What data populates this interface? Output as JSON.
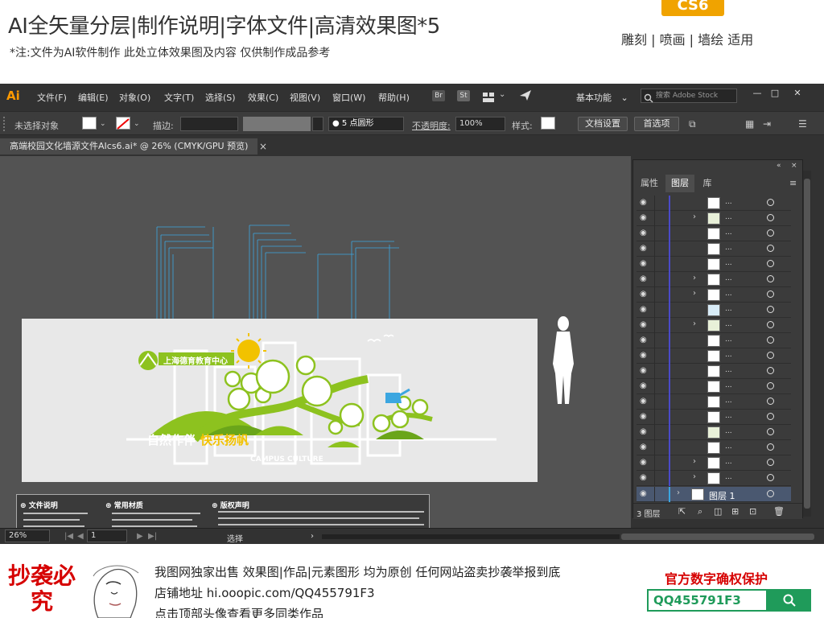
{
  "banner": {
    "title": "AI全矢量分层|制作说明|字体文件|高清效果图*5",
    "note": "*注:文件为AI软件制作 此处立体效果图及内容 仅供制作成品参考",
    "badge": "CS6",
    "right_text": "雕刻 | 喷画 | 墙绘 适用"
  },
  "app": {
    "logo": "Ai",
    "menu": [
      "文件(F)",
      "编辑(E)",
      "对象(O)",
      "文字(T)",
      "选择(S)",
      "效果(C)",
      "视图(V)",
      "窗口(W)",
      "帮助(H)"
    ],
    "br_label": "Br",
    "st_label": "St",
    "workspace": "基本功能",
    "stock_placeholder": "搜索 Adobe Stock",
    "window_controls": [
      "—",
      "□",
      "✕"
    ]
  },
  "controlbar": {
    "no_selection": "未选择对象",
    "stroke_label": "描边:",
    "brush_value": "5 点圆形",
    "opacity_label": "不透明度:",
    "opacity_value": "100%",
    "style_label": "样式:",
    "doc_setup": "文档设置",
    "preferences": "首选项"
  },
  "document": {
    "tab_title": "高端校园文化墙源文件AIcs6.ai* @ 26% (CMYK/GPU 预览)",
    "close": "×"
  },
  "artwork": {
    "org_name": "上海德育教育中心",
    "slogan_white": "自然作伴",
    "slogan_yellow": "快乐扬帆",
    "english": "CAMPUS CULTURE",
    "info_heads": [
      "文件说明",
      "常用材质",
      "版权声明"
    ]
  },
  "status": {
    "zoom": "26%",
    "page": "1",
    "tool": "选择"
  },
  "layers_panel": {
    "tabs": [
      "属性",
      "图层",
      "库"
    ],
    "row_dots": "...",
    "layer_name": "图层 1",
    "layer_count": "3 图层",
    "rows": [
      {
        "expand": false,
        "thumb": "white"
      },
      {
        "expand": true,
        "thumb": "green"
      },
      {
        "expand": false,
        "thumb": "white"
      },
      {
        "expand": false,
        "thumb": "white"
      },
      {
        "expand": false,
        "thumb": "white"
      },
      {
        "expand": true,
        "thumb": "white"
      },
      {
        "expand": true,
        "thumb": "white"
      },
      {
        "expand": false,
        "thumb": "blue"
      },
      {
        "expand": true,
        "thumb": "green"
      },
      {
        "expand": false,
        "thumb": "white"
      },
      {
        "expand": false,
        "thumb": "white"
      },
      {
        "expand": false,
        "thumb": "white"
      },
      {
        "expand": false,
        "thumb": "white"
      },
      {
        "expand": false,
        "thumb": "white"
      },
      {
        "expand": false,
        "thumb": "white"
      },
      {
        "expand": false,
        "thumb": "green"
      },
      {
        "expand": false,
        "thumb": "white"
      },
      {
        "expand": true,
        "thumb": "white"
      },
      {
        "expand": true,
        "thumb": "white"
      }
    ]
  },
  "footer": {
    "stamp": "抄袭必究",
    "line1": "我图网独家出售 效果图|作品|元素图形 均为原创 任何网站盗卖抄袭举报到底",
    "line2": "店铺地址 hi.ooopic.com/QQ455791F3",
    "line3": "点击顶部头像查看更多同类作品",
    "protect": "官方数字确权保护",
    "qq": "QQ455791F3"
  },
  "colors": {
    "accent_green": "#8dc21f",
    "brand_orange": "#ff9a00",
    "qq_green": "#1f9b5a",
    "warning_red": "#d60000"
  }
}
